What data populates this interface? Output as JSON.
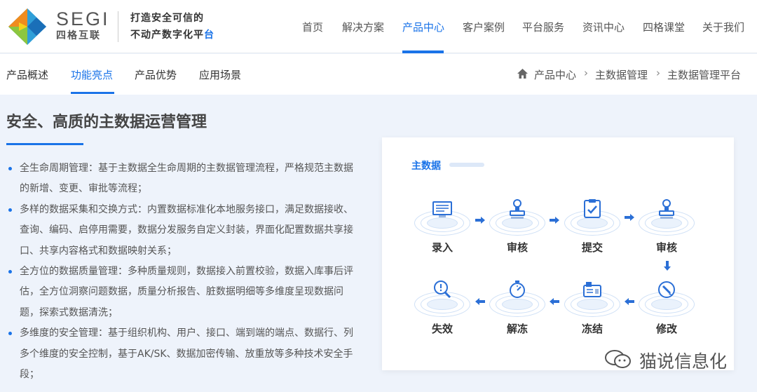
{
  "header": {
    "logo_en": "SEGI",
    "logo_cn": "四格互联",
    "slogan_line1": "打造安全可信的",
    "slogan_line2_plain": "不动产数字化平",
    "slogan_line2_highlight": "台",
    "nav": [
      "首页",
      "解决方案",
      "产品中心",
      "客户案例",
      "平台服务",
      "资讯中心",
      "四格课堂",
      "关于我们"
    ],
    "nav_active": "产品中心"
  },
  "subnav": {
    "tabs": [
      "产品概述",
      "功能亮点",
      "产品优势",
      "应用场景"
    ],
    "active": "功能亮点",
    "breadcrumb": [
      "产品中心",
      "主数据管理",
      "主数据管理平台"
    ]
  },
  "main": {
    "title": "安全、高质的主数据运营管理",
    "features": [
      "全生命周期管理：基于主数据全生命周期的主数据管理流程，严格规范主数据的新增、变更、审批等流程；",
      "多样的数据采集和交换方式：内置数据标准化本地服务接口，满足数据接收、查询、编码、启停用需要，数据分发服务自定义封装，界面化配置数据共享接口、共享内容格式和数据映射关系；",
      "全方位的数据质量管理：多种质量规则，数据接入前置校验，数据入库事后评估，全方位洞察问题数据，质量分析报告、脏数据明细等多维度呈现数据问题，探索式数据清洗；",
      "多维度的安全管理：基于组织机构、用户、接口、端到端的端点、数据行、列多个维度的安全控制，基于AK/SK、数据加密传输、放重放等多种技术安全手段；"
    ]
  },
  "diagram": {
    "title": "主数据",
    "row1": [
      "录入",
      "审核",
      "提交",
      "审核"
    ],
    "row2": [
      "失效",
      "解冻",
      "冻结",
      "修改"
    ]
  },
  "watermark": "猫说信息化",
  "colors": {
    "accent": "#1a73e8",
    "background": "#eef3fb"
  }
}
